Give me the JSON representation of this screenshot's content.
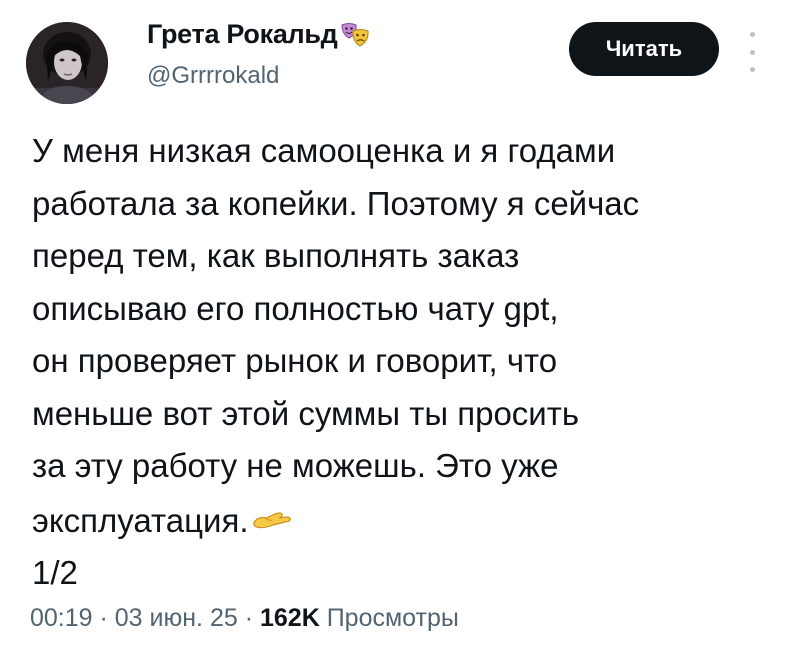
{
  "author": {
    "display_name": "Грета Рокальд",
    "handle": "@Grrrrokald",
    "name_emoji": "performing-arts-masks-icon"
  },
  "follow_button": {
    "label": "Читать"
  },
  "tweet": {
    "lines": [
      "У меня низкая самооценка и я годами",
      "работала за копейки. Поэтому я сейчас",
      "перед тем, как выполнять заказ",
      "описываю его полностью чату gpt,",
      "он проверяет рынок и говорит, что",
      "меньше вот этой суммы ты просить",
      "за эту работу не можешь. Это уже",
      "эксплуатация."
    ],
    "page_counter": "1/2",
    "end_emoji": "hand-pinching-icon"
  },
  "meta": {
    "time": "00:19",
    "separator": " · ",
    "date": "03 июн. 25",
    "views_count": "162K",
    "views_label": "Просмотры"
  },
  "colors": {
    "text_primary": "#0f1419",
    "text_secondary": "#536471",
    "button_bg": "#0f1419",
    "button_text": "#ffffff"
  }
}
